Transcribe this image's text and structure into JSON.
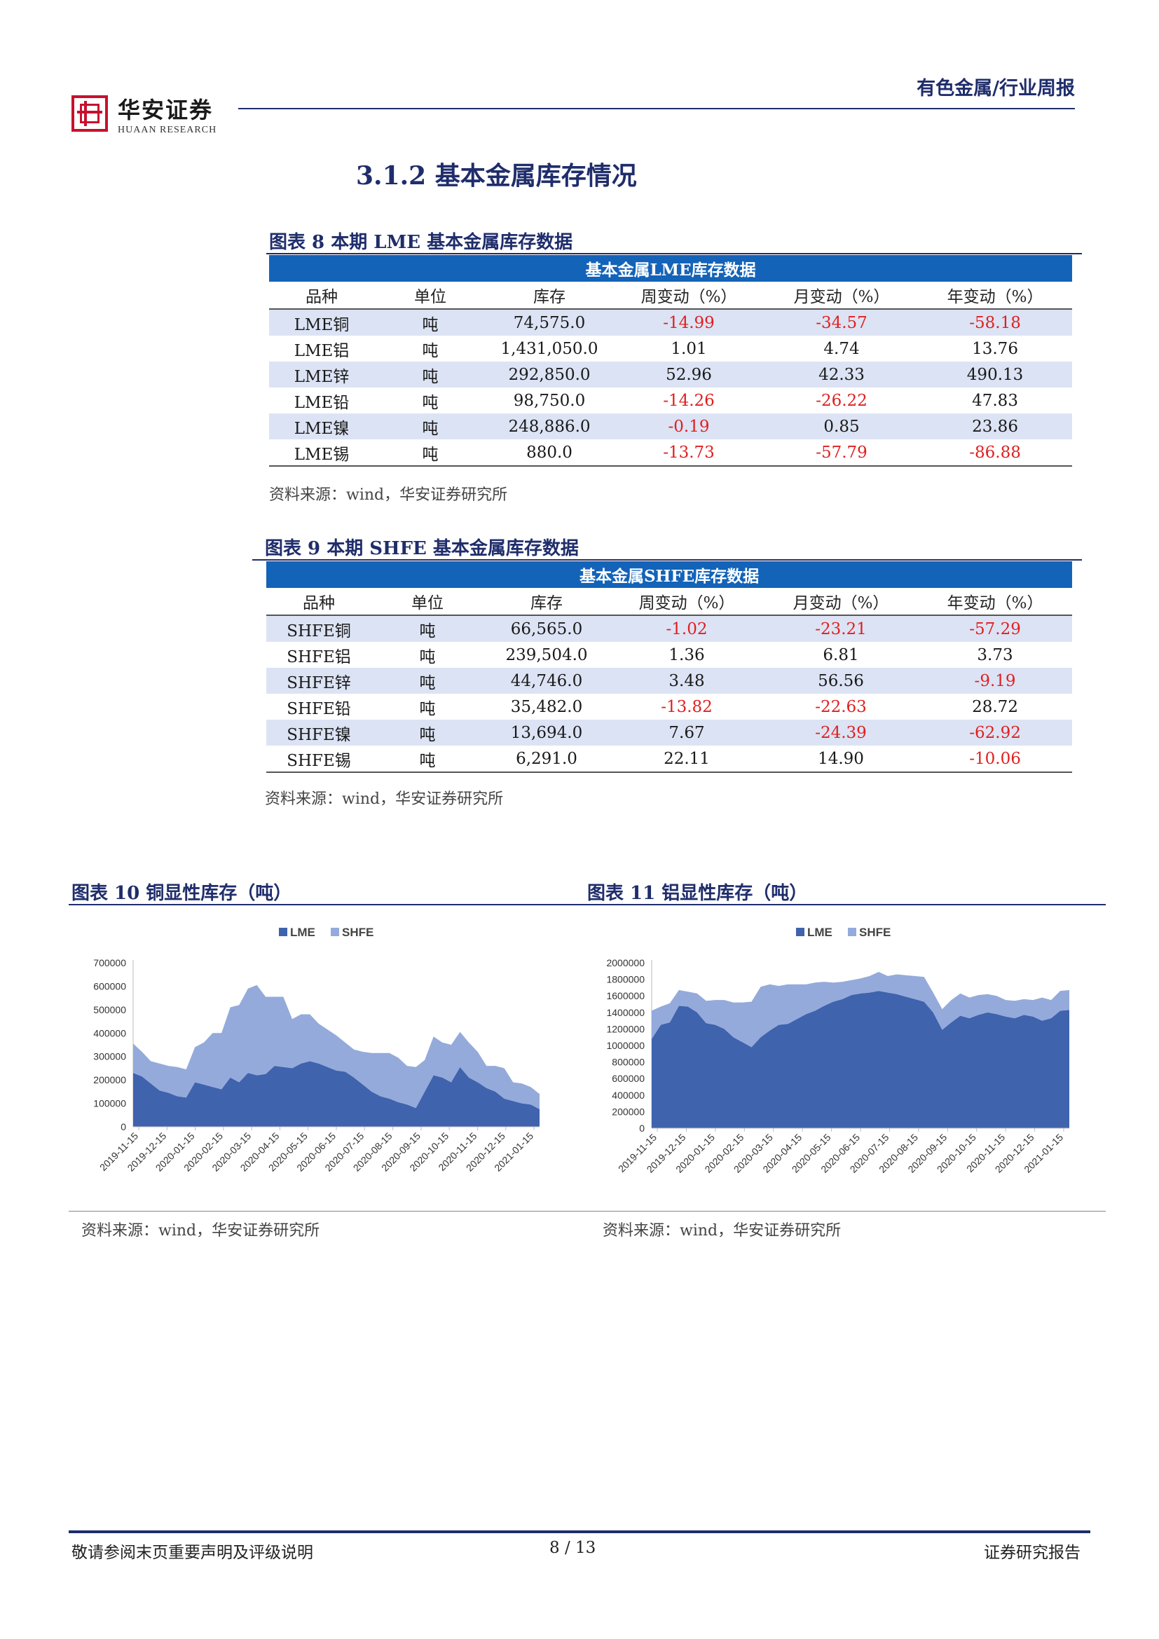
{
  "header": {
    "brand_cn": "华安证券",
    "brand_en": "HUAAN RESEARCH",
    "category": "有色金属/行业周报"
  },
  "section_title": "3.1.2  基本金属库存情况",
  "table_lme": {
    "caption": "图表 8 本期 LME 基本金属库存数据",
    "title": "基本金属LME库存数据",
    "columns": [
      "品种",
      "单位",
      "库存",
      "周变动（%）",
      "月变动（%）",
      "年变动（%）"
    ],
    "rows": [
      [
        "LME铜",
        "吨",
        "74,575.0",
        "-14.99",
        "-34.57",
        "-58.18"
      ],
      [
        "LME铝",
        "吨",
        "1,431,050.0",
        "1.01",
        "4.74",
        "13.76"
      ],
      [
        "LME锌",
        "吨",
        "292,850.0",
        "52.96",
        "42.33",
        "490.13"
      ],
      [
        "LME铅",
        "吨",
        "98,750.0",
        "-14.26",
        "-26.22",
        "47.83"
      ],
      [
        "LME镍",
        "吨",
        "248,886.0",
        "-0.19",
        "0.85",
        "23.86"
      ],
      [
        "LME锡",
        "吨",
        "880.0",
        "-13.73",
        "-57.79",
        "-86.88"
      ]
    ],
    "source": "资料来源：wind，华安证券研究所"
  },
  "table_shfe": {
    "caption": "图表 9 本期 SHFE 基本金属库存数据",
    "title": "基本金属SHFE库存数据",
    "columns": [
      "品种",
      "单位",
      "库存",
      "周变动（%）",
      "月变动（%）",
      "年变动（%）"
    ],
    "rows": [
      [
        "SHFE铜",
        "吨",
        "66,565.0",
        "-1.02",
        "-23.21",
        "-57.29"
      ],
      [
        "SHFE铝",
        "吨",
        "239,504.0",
        "1.36",
        "6.81",
        "3.73"
      ],
      [
        "SHFE锌",
        "吨",
        "44,746.0",
        "3.48",
        "56.56",
        "-9.19"
      ],
      [
        "SHFE铅",
        "吨",
        "35,482.0",
        "-13.82",
        "-22.63",
        "28.72"
      ],
      [
        "SHFE镍",
        "吨",
        "13,694.0",
        "7.67",
        "-24.39",
        "-62.92"
      ],
      [
        "SHFE锡",
        "吨",
        "6,291.0",
        "22.11",
        "14.90",
        "-10.06"
      ]
    ],
    "source": "资料来源：wind，华安证券研究所"
  },
  "chart_data": [
    {
      "type": "area",
      "title": "图表 10 铜显性库存（吨）",
      "source": "资料来源：wind，华安证券研究所",
      "stacked": true,
      "legend": "top-center",
      "ylim": [
        0,
        700000
      ],
      "yticks": [
        "700000",
        "600000",
        "500000",
        "400000",
        "300000",
        "200000",
        "100000",
        "0"
      ],
      "x_tick_labels": [
        "2019-11-15",
        "2019-12-15",
        "2020-01-15",
        "2020-02-15",
        "2020-03-15",
        "2020-04-15",
        "2020-05-15",
        "2020-06-15",
        "2020-07-15",
        "2020-08-15",
        "2020-09-15",
        "2020-10-15",
        "2020-11-15",
        "2020-12-15",
        "2021-01-15"
      ],
      "series": [
        {
          "name": "LME",
          "color": "#3f63ad",
          "values": [
            230000,
            215000,
            185000,
            155000,
            145000,
            130000,
            125000,
            190000,
            180000,
            170000,
            160000,
            210000,
            190000,
            230000,
            220000,
            225000,
            260000,
            255000,
            250000,
            270000,
            280000,
            270000,
            255000,
            240000,
            235000,
            210000,
            180000,
            150000,
            130000,
            120000,
            105000,
            95000,
            80000,
            150000,
            220000,
            210000,
            190000,
            255000,
            210000,
            190000,
            165000,
            150000,
            120000,
            110000,
            100000,
            95000,
            75000
          ]
        },
        {
          "name": "SHFE",
          "color": "#94aadb",
          "values": [
            125000,
            105000,
            95000,
            115000,
            115000,
            125000,
            120000,
            150000,
            180000,
            230000,
            240000,
            300000,
            330000,
            360000,
            385000,
            330000,
            295000,
            300000,
            210000,
            210000,
            200000,
            170000,
            160000,
            150000,
            125000,
            120000,
            140000,
            165000,
            185000,
            195000,
            190000,
            165000,
            175000,
            135000,
            165000,
            150000,
            160000,
            150000,
            150000,
            130000,
            95000,
            110000,
            130000,
            80000,
            85000,
            75000,
            65000
          ]
        }
      ]
    },
    {
      "type": "area",
      "title": "图表 11 铝显性库存（吨）",
      "source": "资料来源：wind，华安证券研究所",
      "stacked": true,
      "legend": "top-center",
      "ylim": [
        0,
        2000000
      ],
      "yticks": [
        "2000000",
        "1800000",
        "1600000",
        "1400000",
        "1200000",
        "1000000",
        "800000",
        "600000",
        "400000",
        "200000",
        "0"
      ],
      "x_tick_labels": [
        "2019-11-15",
        "2019-12-15",
        "2020-01-15",
        "2020-02-15",
        "2020-03-15",
        "2020-04-15",
        "2020-05-15",
        "2020-06-15",
        "2020-07-15",
        "2020-08-15",
        "2020-09-15",
        "2020-10-15",
        "2020-11-15",
        "2020-12-15",
        "2021-01-15"
      ],
      "series": [
        {
          "name": "LME",
          "color": "#3f63ad",
          "values": [
            1080000,
            1250000,
            1280000,
            1480000,
            1470000,
            1400000,
            1270000,
            1250000,
            1200000,
            1100000,
            1040000,
            980000,
            1100000,
            1180000,
            1250000,
            1260000,
            1320000,
            1380000,
            1420000,
            1480000,
            1530000,
            1560000,
            1610000,
            1630000,
            1640000,
            1660000,
            1640000,
            1620000,
            1590000,
            1560000,
            1530000,
            1400000,
            1190000,
            1280000,
            1360000,
            1330000,
            1370000,
            1400000,
            1380000,
            1350000,
            1330000,
            1370000,
            1350000,
            1300000,
            1330000,
            1420000,
            1430000
          ]
        },
        {
          "name": "SHFE",
          "color": "#94aadb",
          "values": [
            340000,
            220000,
            230000,
            190000,
            180000,
            230000,
            270000,
            300000,
            350000,
            420000,
            480000,
            550000,
            610000,
            560000,
            470000,
            480000,
            420000,
            360000,
            340000,
            290000,
            230000,
            210000,
            180000,
            180000,
            200000,
            230000,
            200000,
            240000,
            260000,
            280000,
            300000,
            240000,
            250000,
            270000,
            270000,
            250000,
            240000,
            220000,
            220000,
            200000,
            210000,
            190000,
            200000,
            280000,
            220000,
            240000,
            240000
          ]
        }
      ]
    }
  ],
  "footer": {
    "disclaimer": "敬请参阅末页重要声明及评级说明",
    "page": "8 / 13",
    "report_type": "证券研究报告"
  }
}
